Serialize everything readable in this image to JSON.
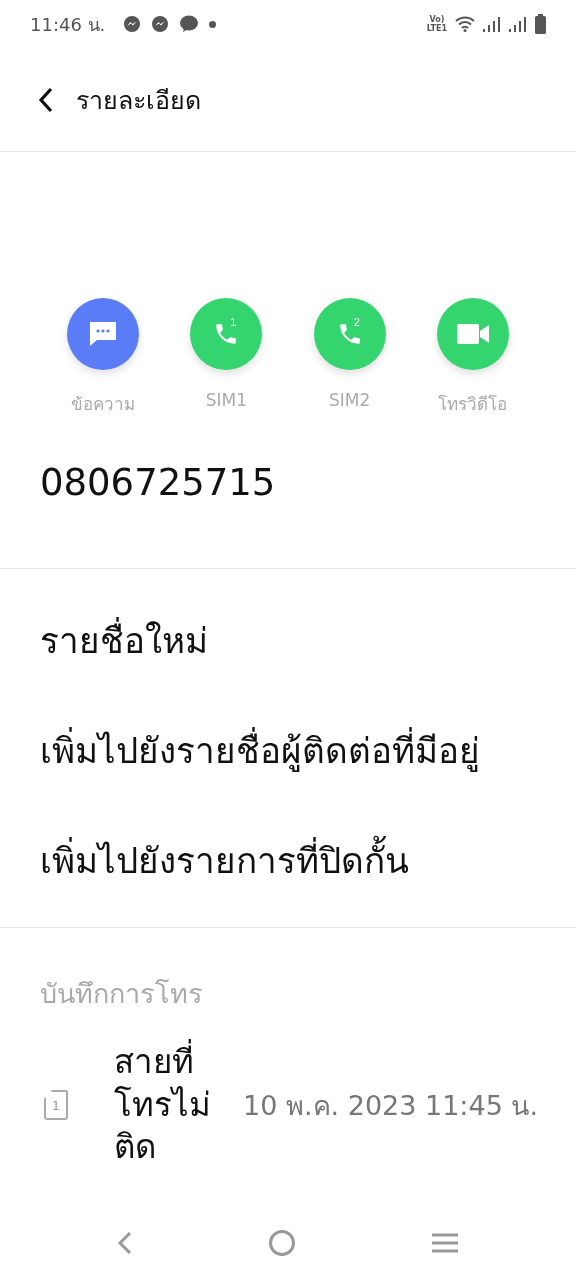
{
  "status_bar": {
    "time": "11:46 น.",
    "volte_lines": [
      "Vo)",
      "LTE1"
    ]
  },
  "header": {
    "title": "รายละเอียด"
  },
  "actions": [
    {
      "kind": "message",
      "label": "ข้อความ"
    },
    {
      "kind": "call",
      "label": "SIM1",
      "badge": "1"
    },
    {
      "kind": "call",
      "label": "SIM2",
      "badge": "2"
    },
    {
      "kind": "video",
      "label": "โทรวิดีโอ"
    }
  ],
  "phone_number": "0806725715",
  "menu_items": [
    "รายชื่อใหม่",
    "เพิ่มไปยังรายชื่อผู้ติดต่อที่มีอยู่",
    "เพิ่มไปยังรายการที่ปิดกั้น"
  ],
  "call_log": {
    "heading": "บันทึกการโทร",
    "entries": [
      {
        "sim": "1",
        "type": "สายที่โทรไม่ติด",
        "datetime": "10 พ.ค. 2023 11:45 น."
      }
    ]
  }
}
